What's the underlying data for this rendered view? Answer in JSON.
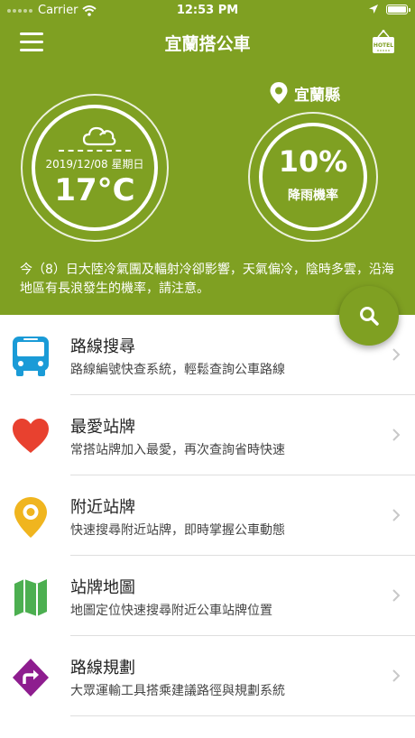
{
  "status_bar": {
    "carrier": "Carrier",
    "time": "12:53 PM"
  },
  "nav": {
    "title": "宜蘭搭公車",
    "hotel_sign": "HOTEL"
  },
  "weather": {
    "date": "2019/12/08 星期日",
    "temperature": "17°C",
    "location": "宜蘭縣",
    "rain_probability": "10%",
    "rain_label": "降雨機率",
    "notice": "今（8）日大陸冷氣團及輻射冷卻影響，天氣偏冷，陰時多雲，沿海地區有長浪發生的機率，請注意。"
  },
  "menu": [
    {
      "title": "路線搜尋",
      "desc": "路線編號快查系統，輕鬆查詢公車路線",
      "icon": "bus-icon",
      "color": "#1a9bd7"
    },
    {
      "title": "最愛站牌",
      "desc": "常搭站牌加入最愛，再次查詢省時快速",
      "icon": "heart-icon",
      "color": "#e8412f"
    },
    {
      "title": "附近站牌",
      "desc": "快速搜尋附近站牌，即時掌握公車動態",
      "icon": "map-pin-icon",
      "color": "#f0b51f"
    },
    {
      "title": "站牌地圖",
      "desc": "地圖定位快速搜尋附近公車站牌位置",
      "icon": "map-icon",
      "color": "#4caf50"
    },
    {
      "title": "路線規劃",
      "desc": "大眾運輸工具搭乘建議路徑與規劃系統",
      "icon": "route-icon",
      "color": "#8e1d8f"
    }
  ],
  "colors": {
    "header_green": "#7fa022"
  }
}
